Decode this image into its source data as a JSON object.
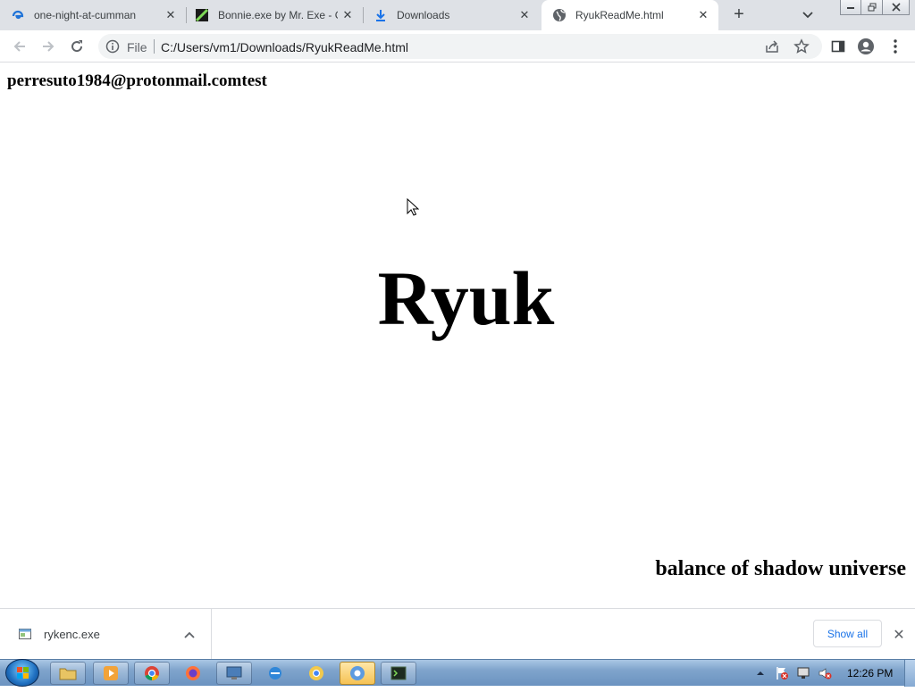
{
  "browser": {
    "tabs": [
      {
        "title": "one-night-at-cumman",
        "favicon": "edge-like-icon",
        "active": false
      },
      {
        "title": "Bonnie.exe by Mr. Exe - G",
        "favicon": "itch-icon",
        "active": false
      },
      {
        "title": "Downloads",
        "favicon": "download-icon",
        "active": false
      },
      {
        "title": "RyukReadMe.html",
        "favicon": "globe-icon",
        "active": true
      }
    ],
    "omnibox": {
      "scheme_label": "File",
      "url": "C:/Users/vm1/Downloads/RyukReadMe.html"
    }
  },
  "page": {
    "email": "perresuto1984@protonmail.comtest",
    "headline": "Ryuk",
    "motto": "balance of shadow universe"
  },
  "downloads": {
    "file_name": "rykenc.exe",
    "show_all_label": "Show all"
  },
  "taskbar": {
    "apps": [
      "explorer",
      "media-player",
      "chrome",
      "firefox",
      "computer",
      "ie",
      "chrome-canary",
      "chrome-active",
      "terminal"
    ],
    "clock": "12:26 PM"
  },
  "colors": {
    "tabstrip_bg": "#dee1e6",
    "omnibox_bg": "#f1f3f4",
    "link_blue": "#1a73e8",
    "taskbar_blue": "#7fa4cc"
  }
}
